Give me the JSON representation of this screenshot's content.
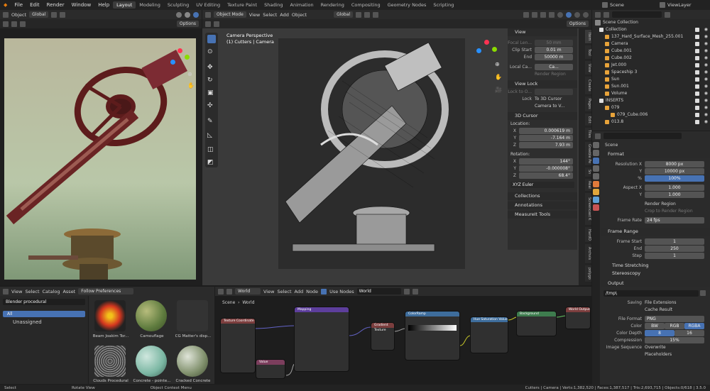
{
  "menu": [
    "File",
    "Edit",
    "Render",
    "Window",
    "Help"
  ],
  "workspaces": [
    "Layout",
    "Modeling",
    "Sculpting",
    "UV Editing",
    "Texture Paint",
    "Shading",
    "Animation",
    "Rendering",
    "Compositing",
    "Geometry Nodes",
    "Scripting"
  ],
  "active_workspace": "Layout",
  "scene_name": "Scene",
  "view_layer": "ViewLayer",
  "left_view": {
    "mode": "Object",
    "orient": "Global",
    "options": "Options"
  },
  "main_view": {
    "mode": "Object Mode",
    "menu": [
      "View",
      "Select",
      "Add",
      "Object"
    ],
    "orient": "Global",
    "options": "Options",
    "camera_line1": "Camera Perspective",
    "camera_line2": "(1) Cutters | Camera"
  },
  "npanel": {
    "view_title": "View",
    "focal_label": "Focal Len...",
    "focal_value": "50 mm",
    "clip_start_label": "Clip Start",
    "clip_start_value": "0.01 m",
    "end_label": "End",
    "end_value": "50000 m",
    "local_camera_label": "Local Ca...",
    "local_camera_value": "Ca...",
    "render_region": "Render Region",
    "view_lock": "View Lock",
    "lock_to_obj": "Lock to O...",
    "lock_label": "Lock",
    "to_3d_cursor": "To 3D Cursor",
    "camera_to_view": "Camera to V...",
    "cursor_title": "3D Cursor",
    "location": "Location:",
    "loc_x": "0.000619 m",
    "loc_y": "-7.164 m",
    "loc_z": "7.93 m",
    "rotation": "Rotation:",
    "rot_x": "144°",
    "rot_y": "-0.000008°",
    "rot_z": "68.4°",
    "rot_mode": "XYZ Euler",
    "collections": "Collections",
    "annotations": "Annotations",
    "measureit": "MeasureIt Tools"
  },
  "npanel_tabs": [
    "Item",
    "Tool",
    "View",
    "Create",
    "Pages",
    "Edit",
    "Tiles",
    "Greeble Pe",
    "Sn",
    "Real",
    "Screencast K",
    "HardO",
    "Archvis",
    "polygo"
  ],
  "outliner": {
    "title": "Scene Collection",
    "items": [
      {
        "name": "Collection",
        "indent": 0
      },
      {
        "name": "137_Hard_Surface_Mesh_255.001",
        "indent": 1
      },
      {
        "name": "Camera",
        "indent": 1
      },
      {
        "name": "Cube.001",
        "indent": 1
      },
      {
        "name": "Cube.002",
        "indent": 1
      },
      {
        "name": "Jet.000",
        "indent": 1
      },
      {
        "name": "Spaceship 3",
        "indent": 1
      },
      {
        "name": "Sun",
        "indent": 1
      },
      {
        "name": "Sun.001",
        "indent": 1
      },
      {
        "name": "Volume",
        "indent": 1
      },
      {
        "name": "INSERTS",
        "indent": 0
      },
      {
        "name": "079",
        "indent": 1
      },
      {
        "name": "079_Cube.006",
        "indent": 2
      },
      {
        "name": "013.8",
        "indent": 1
      }
    ]
  },
  "properties": {
    "scene": "Scene",
    "format": "Format",
    "res_x_label": "Resolution X",
    "res_x": "8000 px",
    "res_y_label": "Y",
    "res_y": "10000 px",
    "pct_label": "%",
    "pct": "100%",
    "aspect_x_label": "Aspect X",
    "aspect_x": "1.000",
    "aspect_y_label": "Y",
    "aspect_y": "1.000",
    "render_region": "Render Region",
    "crop": "Crop to Render Region",
    "frame_rate_label": "Frame Rate",
    "frame_rate": "24 fps",
    "frame_range": "Frame Range",
    "frame_start_label": "Frame Start",
    "frame_start": "1",
    "end_label": "End",
    "end": "250",
    "step_label": "Step",
    "step": "1",
    "time_stretching": "Time Stretching",
    "stereoscopy": "Stereoscopy",
    "output": "Output",
    "path": "/tmp\\",
    "saving_label": "Saving",
    "file_ext": "File Extensions",
    "cache": "Cache Result",
    "file_format_label": "File Format",
    "file_format": "PNG",
    "color_label": "Color",
    "color_opts": [
      "BW",
      "RGB",
      "RGBA"
    ],
    "depth_label": "Color Depth",
    "depth_opts": [
      "8",
      "16"
    ],
    "compression_label": "Compression",
    "compression": "15%",
    "image_seq_label": "Image Sequence",
    "overwrite": "Overwrite",
    "placeholders": "Placeholders"
  },
  "asset_browser": {
    "menu": [
      "View",
      "Select",
      "Catalog",
      "Asset"
    ],
    "filter": "Follow Preferences",
    "library": "Blender procedural",
    "catalog_all": "All",
    "unassigned": "Unassigned",
    "assets": [
      "Beam Joakim Tor...",
      "Camouflage",
      "CG Matter's disp...",
      "Clouds Procedural",
      "Concrete - pointe...",
      "Cracked Concrete"
    ]
  },
  "node_editor": {
    "menu": [
      "View",
      "Select",
      "Add",
      "Node"
    ],
    "world_label": "World",
    "use_nodes": "Use Nodes",
    "world_name": "World",
    "breadcrumb_scene": "Scene",
    "breadcrumb_world": "World",
    "nodes": [
      "Texture Coordinate",
      "Mapping",
      "Gradient Texture",
      "ColorRamp",
      "Hue Saturation Value",
      "Background",
      "World Output",
      "Value"
    ]
  },
  "statusbar": {
    "select": "Select",
    "rotate": "Rotate View",
    "context": "Object Context Menu",
    "stats": "Cutters | Camera | Verts:1,382,520 | Faces:1,387,517 | Tris:2,693,715 | Objects:0/618 | 3.5.0"
  },
  "colors": {
    "accent": "#4772b3",
    "header": "#2b2b2b",
    "active_orange": "#e8a33a"
  }
}
